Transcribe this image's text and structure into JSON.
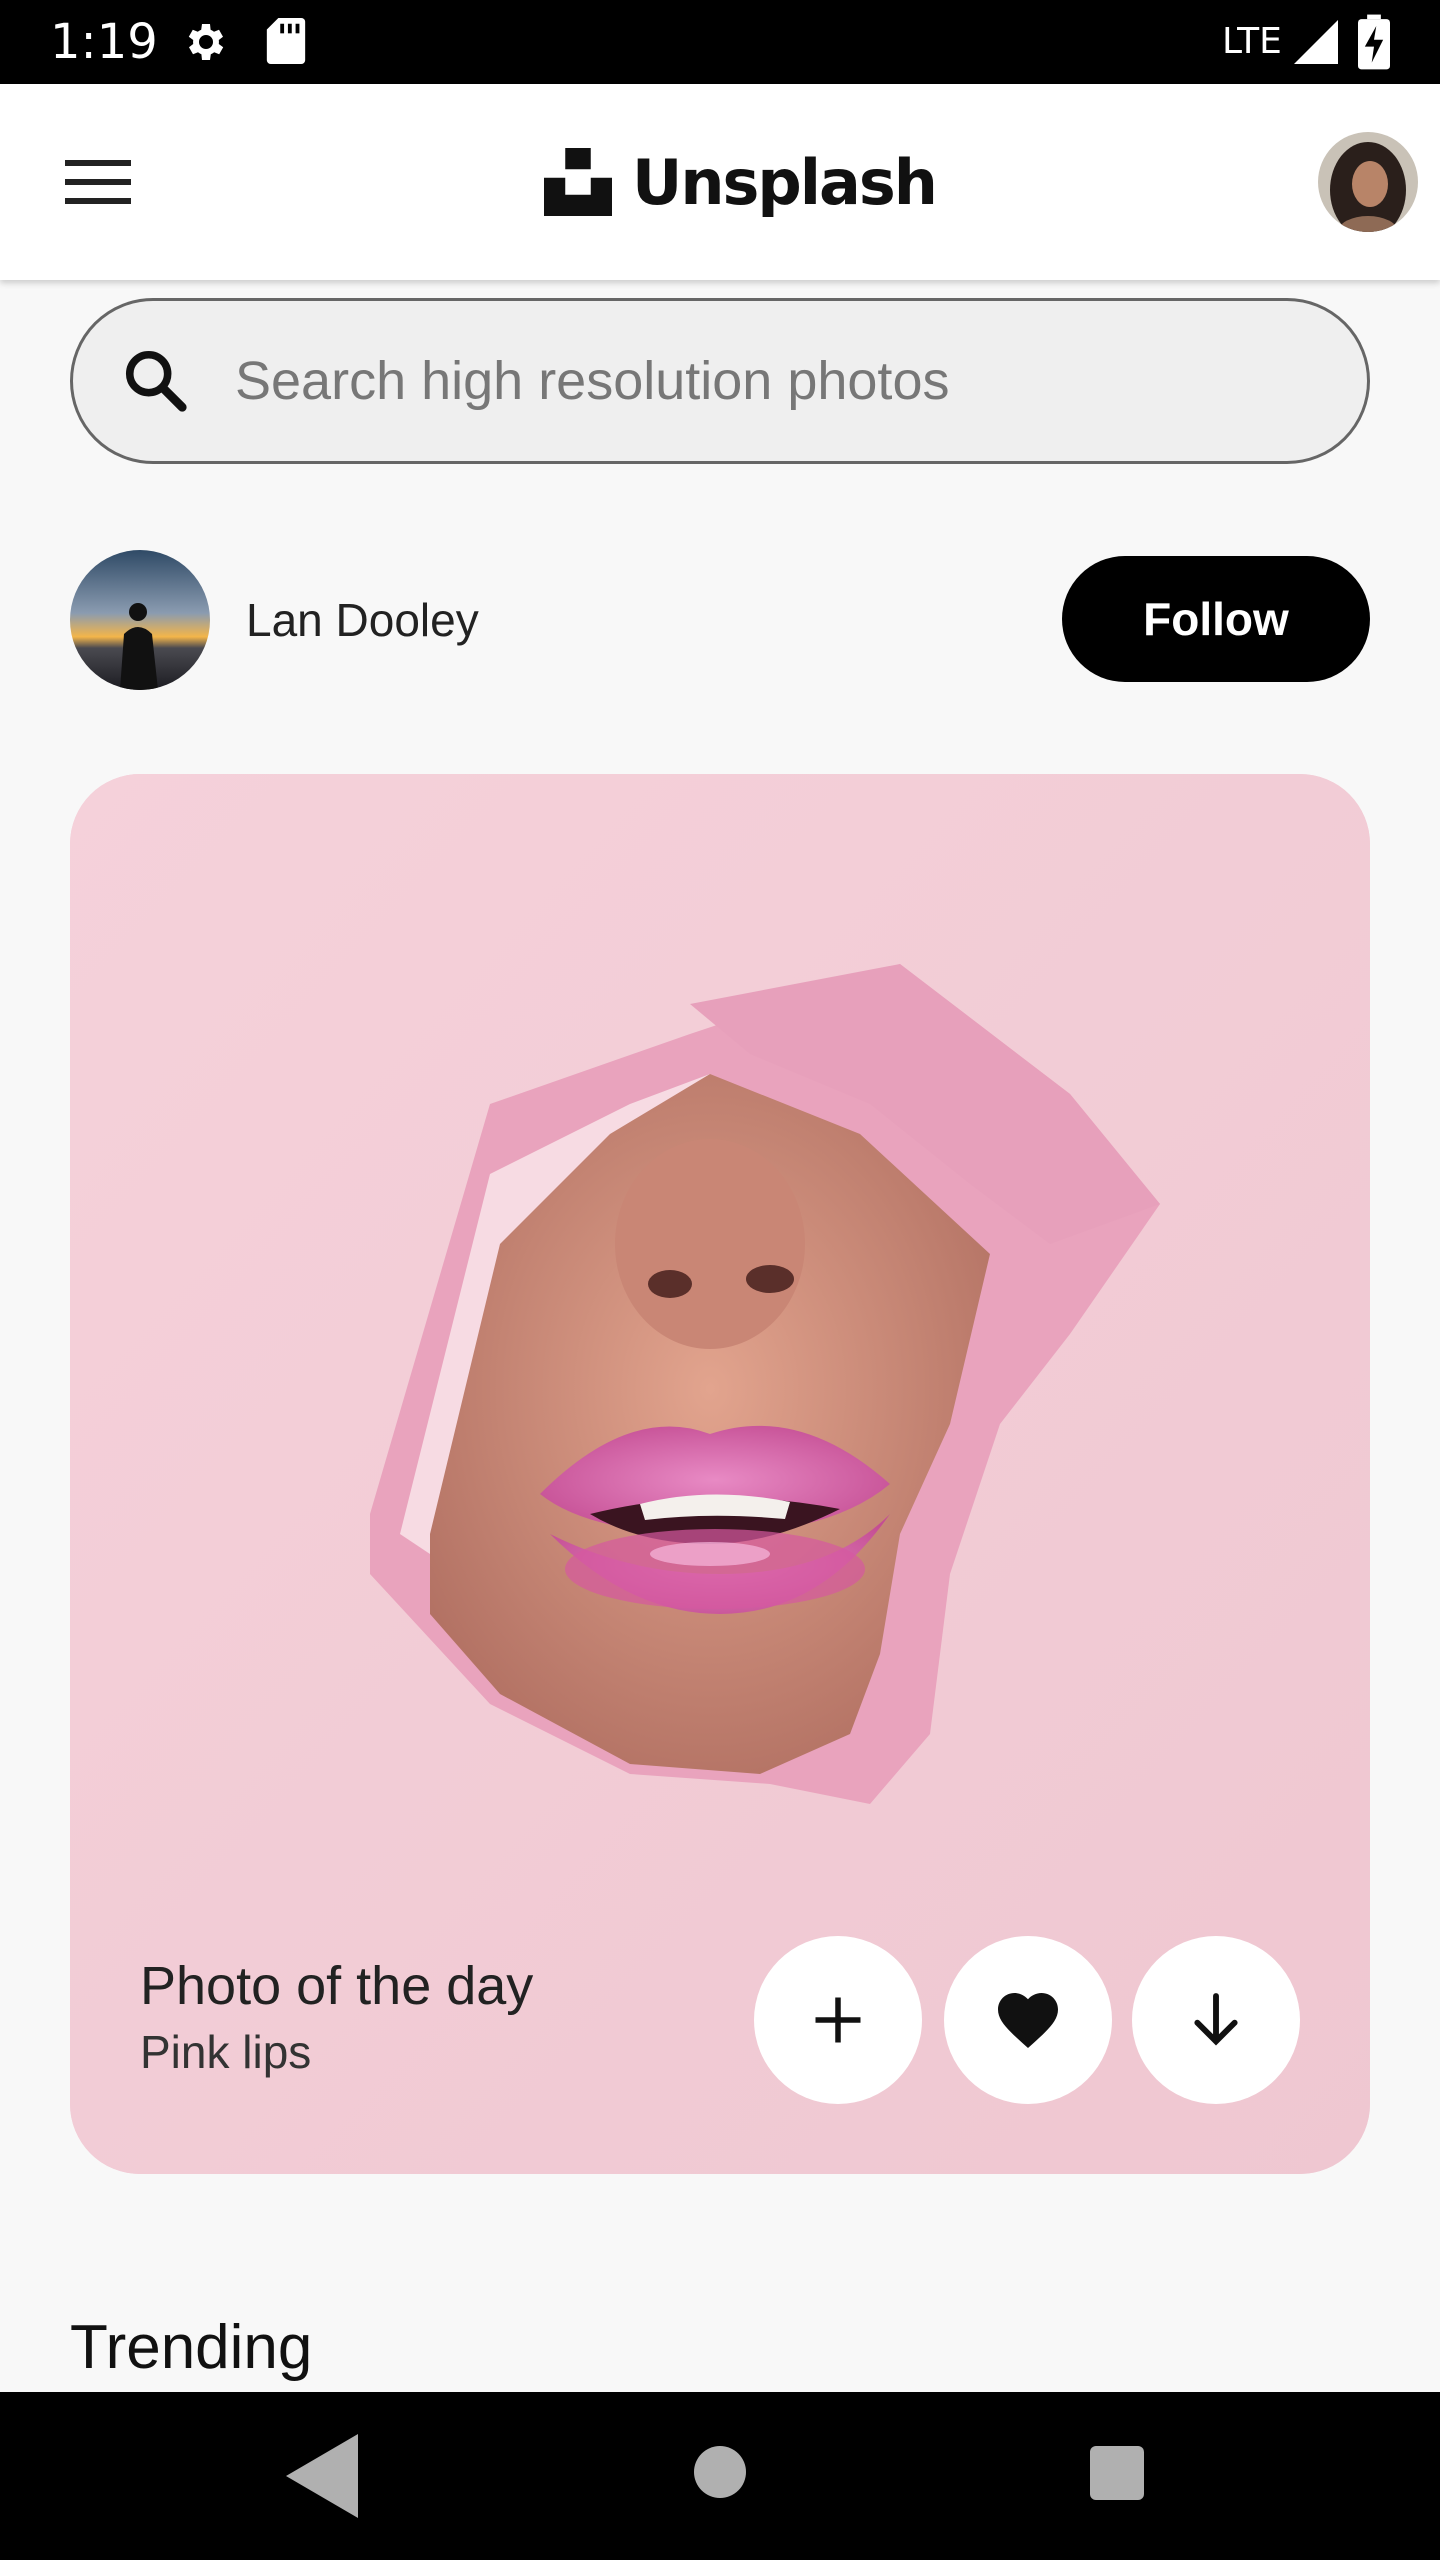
{
  "status_bar": {
    "time": "1:19",
    "network": "LTE",
    "icons": [
      "settings-gear-icon",
      "sd-card-icon",
      "cell-signal-icon",
      "battery-charging-icon"
    ]
  },
  "app_bar": {
    "brand": "Unsplash",
    "menu_icon": "hamburger-menu-icon"
  },
  "search": {
    "placeholder": "Search high resolution photos",
    "value": ""
  },
  "author": {
    "name": "Lan Dooley",
    "follow_label": "Follow"
  },
  "photo_card": {
    "title": "Photo of the day",
    "subtitle": "Pink lips",
    "actions": [
      "add-icon",
      "heart-icon",
      "download-arrow-icon"
    ]
  },
  "sections": {
    "trending": "Trending"
  },
  "colors": {
    "accent": "#000000",
    "background": "#f8f8f8",
    "card_pink": "#f2cfd8"
  }
}
